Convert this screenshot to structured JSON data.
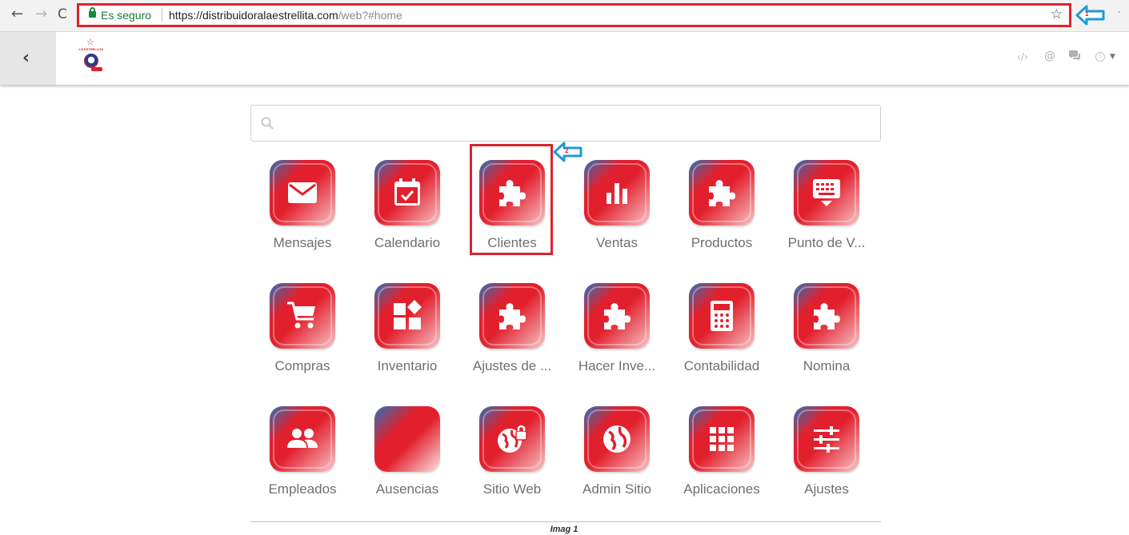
{
  "browser": {
    "back_icon": "back-arrow-icon",
    "forward_icon": "forward-arrow-icon",
    "reload_icon": "reload-icon",
    "secure_label": "Es seguro",
    "url_host": "https://distribuidoralaestrellita.com",
    "url_path": "/web?#home",
    "bookmark_icon": "star-icon",
    "annotation_1": "1",
    "annotation_2": "2",
    "annotation_color": "#d9242f",
    "arrow_color": "#1e9ad6"
  },
  "header": {
    "back_icon": "chevron-left-icon",
    "logo_text": "LA ESTRELLITA",
    "systray": [
      "code-icon",
      "at-icon",
      "chat-icon",
      "user-avatar-icon"
    ]
  },
  "search": {
    "placeholder": "",
    "value": ""
  },
  "apps": [
    {
      "label": "Mensajes",
      "icon": "envelope-icon"
    },
    {
      "label": "Calendario",
      "icon": "calendar-check-icon"
    },
    {
      "label": "Clientes",
      "icon": "puzzle-icon"
    },
    {
      "label": "Ventas",
      "icon": "bar-chart-icon"
    },
    {
      "label": "Productos",
      "icon": "puzzle-icon"
    },
    {
      "label": "Punto de V...",
      "icon": "keyboard-icon"
    },
    {
      "label": "Compras",
      "icon": "shopping-cart-icon"
    },
    {
      "label": "Inventario",
      "icon": "blocks-icon"
    },
    {
      "label": "Ajustes de ...",
      "icon": "puzzle-icon"
    },
    {
      "label": "Hacer Inve...",
      "icon": "puzzle-icon"
    },
    {
      "label": "Contabilidad",
      "icon": "calculator-icon"
    },
    {
      "label": "Nomina",
      "icon": "puzzle-icon"
    },
    {
      "label": "Empleados",
      "icon": "people-icon"
    },
    {
      "label": "Ausencias",
      "icon": "blank-icon"
    },
    {
      "label": "Sitio Web",
      "icon": "globe-lock-icon"
    },
    {
      "label": "Admin Sitio",
      "icon": "globe-icon"
    },
    {
      "label": "Aplicaciones",
      "icon": "grid-icon"
    },
    {
      "label": "Ajustes",
      "icon": "sliders-icon"
    }
  ],
  "highlighted_app": "Clientes",
  "caption": "Imag 1",
  "colors": {
    "tile_gradient_start": "#2d6fb7",
    "tile_gradient_mid": "#e2202d",
    "label_color": "#6f6f6f"
  }
}
